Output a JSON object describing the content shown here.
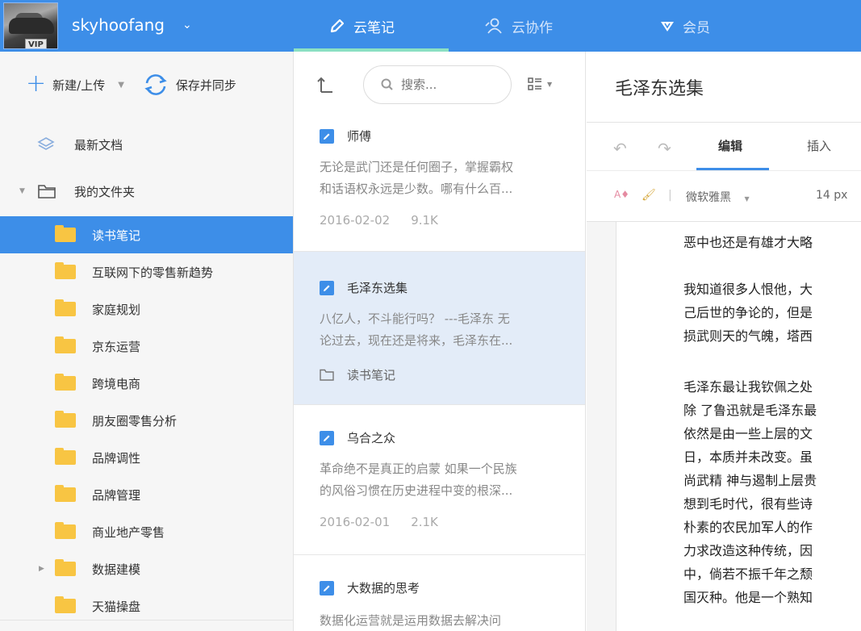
{
  "topbar": {
    "username": "skyhoofang",
    "vip_badge": "VIP",
    "tabs": [
      {
        "label": "云笔记",
        "active": true
      },
      {
        "label": "云协作",
        "active": false
      },
      {
        "label": "会员",
        "active": false
      }
    ],
    "accent_color": "#3d8ee8",
    "underline_color": "#8be0c2"
  },
  "sidebar": {
    "new_upload_label": "新建/上传",
    "save_sync_label": "保存并同步",
    "recent_docs": "最新文档",
    "my_folders": "我的文件夹",
    "folders": [
      {
        "label": "读书笔记",
        "active": true,
        "expandable": false
      },
      {
        "label": "互联网下的零售新趋势",
        "active": false,
        "expandable": false
      },
      {
        "label": "家庭规划",
        "active": false,
        "expandable": false
      },
      {
        "label": "京东运营",
        "active": false,
        "expandable": false
      },
      {
        "label": "跨境电商",
        "active": false,
        "expandable": false
      },
      {
        "label": "朋友圈零售分析",
        "active": false,
        "expandable": false
      },
      {
        "label": "品牌调性",
        "active": false,
        "expandable": false
      },
      {
        "label": "品牌管理",
        "active": false,
        "expandable": false
      },
      {
        "label": "商业地产零售",
        "active": false,
        "expandable": false
      },
      {
        "label": "数据建模",
        "active": false,
        "expandable": true
      },
      {
        "label": "天猫操盘",
        "active": false,
        "expandable": false
      }
    ]
  },
  "notelist": {
    "search_placeholder": "搜索...",
    "notes": [
      {
        "title": "师傅",
        "snippet1": "无论是武门还是任何圈子，掌握霸权",
        "snippet2": "和话语权永远是少数。哪有什么百...",
        "date": "2016-02-02",
        "size": "9.1K"
      },
      {
        "title": "毛泽东选集",
        "snippet1": "八亿人，不斗能行吗？ ---毛泽东 无",
        "snippet2": "论过去，现在还是将来，毛泽东在...",
        "folder": "读书笔记"
      },
      {
        "title": "乌合之众",
        "snippet1": "革命绝不是真正的启蒙 如果一个民族",
        "snippet2": "的风俗习惯在历史进程中变的根深...",
        "date": "2016-02-01",
        "size": "2.1K"
      },
      {
        "title": "大数据的思考",
        "snippet1": "数据化运营就是运用数据去解决问"
      }
    ]
  },
  "editor": {
    "title": "毛泽东选集",
    "tab_edit": "编辑",
    "tab_insert": "插入",
    "font_name": "微软雅黑",
    "font_size": "14 px",
    "lines": [
      "恶中也还是有雄才大略",
      "我知道很多人恨他，大",
      "己后世的争论的，但是",
      "损武则天的气魄，塔西",
      "毛泽东最让我钦佩之处",
      "除 了鲁迅就是毛泽东最",
      "依然是由一些上层的文",
      "日，本质并未改变。虽",
      "尚武精 神与遏制上层贵",
      "想到毛时代，很有些诗",
      "朴素的农民加军人的作",
      "力求改造这种传统，因",
      "中，倘若不振千年之颓",
      "国灭种。他是一个熟知"
    ]
  }
}
